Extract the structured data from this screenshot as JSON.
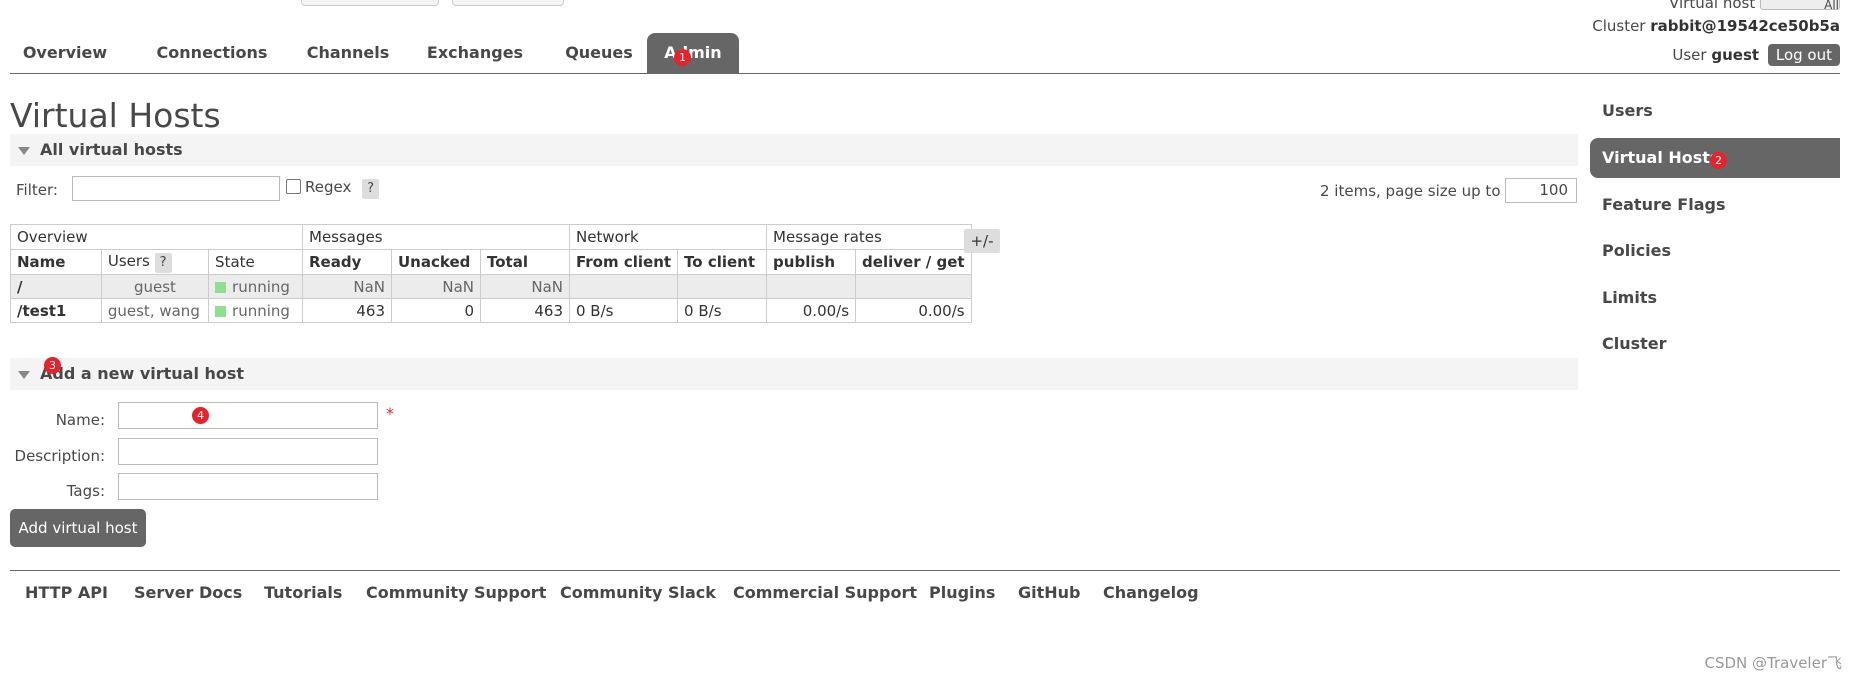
{
  "header": {
    "virtual_host_label": "Virtual host",
    "virtual_host_value": "All",
    "cluster_label": "Cluster",
    "cluster_value": "rabbit@19542ce50b5a",
    "user_label": "User",
    "user_value": "guest",
    "logout_label": "Log out"
  },
  "nav": {
    "tabs": [
      {
        "label": "Overview"
      },
      {
        "label": "Connections"
      },
      {
        "label": "Channels"
      },
      {
        "label": "Exchanges"
      },
      {
        "label": "Queues"
      },
      {
        "label": "Admin",
        "active": true
      }
    ]
  },
  "page": {
    "title": "Virtual Hosts",
    "all_section_title": "All virtual hosts",
    "filter_label": "Filter:",
    "filter_value": "",
    "regex_label": "Regex",
    "help_label": "?",
    "items_text": "2 items, page size up to",
    "page_size": "100",
    "toggle_columns_label": "+/-"
  },
  "table": {
    "groups": [
      "Overview",
      "Messages",
      "Network",
      "Message rates"
    ],
    "columns": [
      "Name",
      "Users",
      "State",
      "Ready",
      "Unacked",
      "Total",
      "From client",
      "To client",
      "publish",
      "deliver / get"
    ],
    "rows": [
      {
        "name": "/",
        "users": "guest",
        "state": "running",
        "ready": "NaN",
        "unacked": "NaN",
        "total": "NaN",
        "from_client": "",
        "to_client": "",
        "publish": "",
        "deliver_get": ""
      },
      {
        "name": "/test1",
        "users": "guest, wang",
        "state": "running",
        "ready": "463",
        "unacked": "0",
        "total": "463",
        "from_client": "0 B/s",
        "to_client": "0 B/s",
        "publish": "0.00/s",
        "deliver_get": "0.00/s"
      }
    ]
  },
  "add_section": {
    "title": "Add a new virtual host",
    "name_label": "Name:",
    "description_label": "Description:",
    "tags_label": "Tags:",
    "required_mark": "*",
    "submit_label": "Add virtual host"
  },
  "sidebar": {
    "items": [
      {
        "label": "Users"
      },
      {
        "label": "Virtual Hosts",
        "active": true
      },
      {
        "label": "Feature Flags"
      },
      {
        "label": "Policies"
      },
      {
        "label": "Limits"
      },
      {
        "label": "Cluster"
      }
    ]
  },
  "footer": {
    "links": [
      "HTTP API",
      "Server Docs",
      "Tutorials",
      "Community Support",
      "Community Slack",
      "Commercial Support",
      "Plugins",
      "GitHub",
      "Changelog"
    ]
  },
  "annotations": {
    "b1": "1",
    "b2": "2",
    "b3": "3",
    "b4": "4"
  },
  "watermark": "CSDN @Traveler飞",
  "colors": {
    "accent": "#666666",
    "badge": "#e8212b",
    "running": "#8ee08e"
  }
}
